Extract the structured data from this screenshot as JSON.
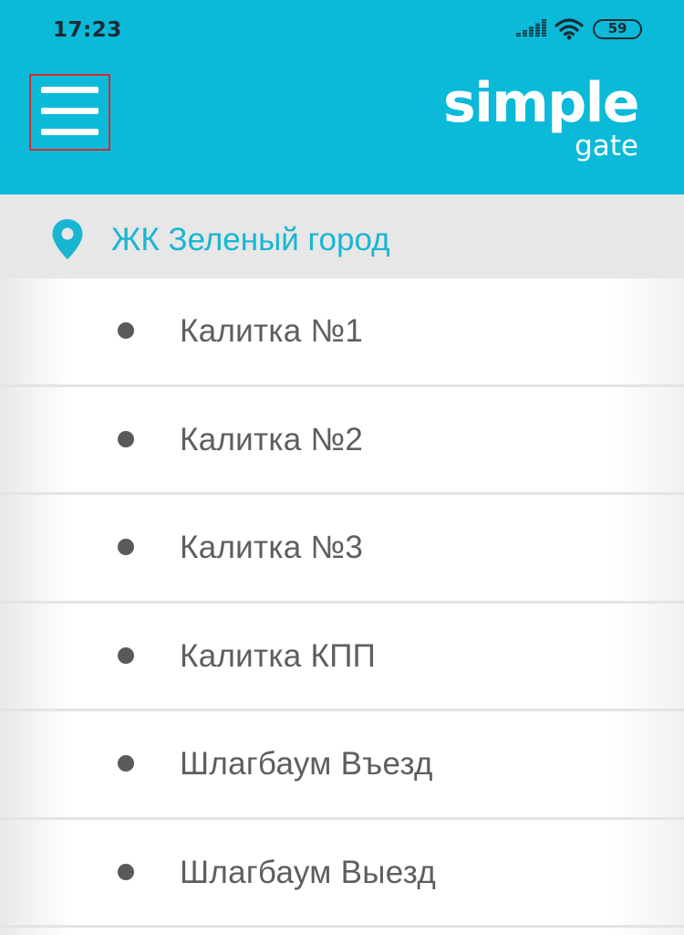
{
  "status_bar": {
    "time": "17:23",
    "battery_level": "59",
    "icons": [
      "signal-icon",
      "wifi-icon",
      "battery-icon"
    ]
  },
  "header": {
    "menu_icon": "hamburger-menu-icon",
    "logo": {
      "word1": "simple",
      "word2": "gate"
    },
    "colors": {
      "background": "#0bbad8",
      "highlight_border": "#d9272e"
    }
  },
  "location": {
    "icon": "map-pin-icon",
    "name": "ЖК Зеленый город",
    "color": "#19b6d2"
  },
  "gates": [
    {
      "label": "Калитка №1"
    },
    {
      "label": "Калитка №2"
    },
    {
      "label": "Калитка №3"
    },
    {
      "label": "Калитка КПП"
    },
    {
      "label": "Шлагбаум Въезд"
    },
    {
      "label": "Шлагбаум Выезд"
    }
  ]
}
